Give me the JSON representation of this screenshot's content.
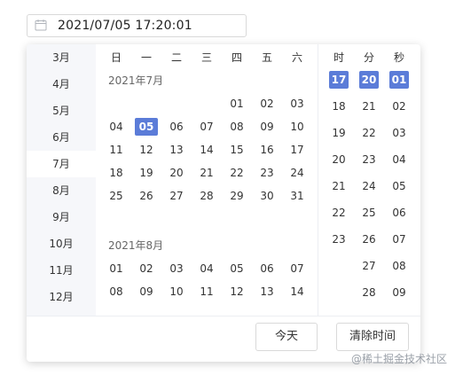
{
  "input": {
    "value": "2021/07/05 17:20:01"
  },
  "months": {
    "items": [
      "3月",
      "4月",
      "5月",
      "6月",
      "7月",
      "8月",
      "9月",
      "10月",
      "11月",
      "12月"
    ],
    "active_index": 4
  },
  "weekdays": [
    "日",
    "一",
    "二",
    "三",
    "四",
    "五",
    "六"
  ],
  "calendar": {
    "month1": {
      "title": "2021年7月",
      "rows": [
        [
          "",
          "",
          "",
          "",
          "01",
          "02",
          "03"
        ],
        [
          "04",
          "05",
          "06",
          "07",
          "08",
          "09",
          "10"
        ],
        [
          "11",
          "12",
          "13",
          "14",
          "15",
          "16",
          "17"
        ],
        [
          "18",
          "19",
          "20",
          "21",
          "22",
          "23",
          "24"
        ],
        [
          "25",
          "26",
          "27",
          "28",
          "29",
          "30",
          "31"
        ]
      ],
      "selected_day": "05"
    },
    "month2": {
      "title": "2021年8月",
      "rows": [
        [
          "01",
          "02",
          "03",
          "04",
          "05",
          "06",
          "07"
        ],
        [
          "08",
          "09",
          "10",
          "11",
          "12",
          "13",
          "14"
        ]
      ]
    }
  },
  "time": {
    "headers": {
      "hour": "时",
      "minute": "分",
      "second": "秒"
    },
    "hours": [
      "17",
      "18",
      "19",
      "20",
      "21",
      "22",
      "23"
    ],
    "minutes": [
      "20",
      "21",
      "22",
      "23",
      "24",
      "25",
      "26",
      "27",
      "28"
    ],
    "seconds": [
      "01",
      "02",
      "03",
      "04",
      "05",
      "06",
      "07",
      "08",
      "09"
    ],
    "selected": {
      "hour": "17",
      "minute": "20",
      "second": "01"
    }
  },
  "footer": {
    "today_label": "今天",
    "clear_label": "清除时间"
  },
  "watermark": "@稀土掘金技术社区",
  "colors": {
    "accent": "#5b7cd8",
    "sidebar_bg": "#f6f7fa"
  }
}
